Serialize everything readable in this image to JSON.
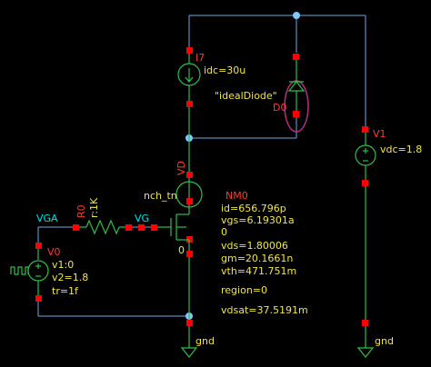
{
  "colors": {
    "background": "#000000",
    "wire": "#6fa8e6",
    "pin": "#ff0000",
    "component": "#2fbf4a",
    "label_red": "#ff3b30",
    "label_yellow": "#f0e642",
    "label_cyan": "#00e0e0",
    "highlight": "#b0327e",
    "junction": "#7ec8ff"
  },
  "components": {
    "i7": {
      "name": "I7",
      "param": "idc=30u"
    },
    "d0": {
      "name": "D0",
      "model": "\"idealDiode\""
    },
    "v1": {
      "name": "V1",
      "param": "vdc=1.8"
    },
    "nm0": {
      "device": "nch_tn",
      "name": "NM0",
      "bulk": "0",
      "op": {
        "id": "id=656.796p",
        "vgs": "vgs=6.19301a",
        "blank": "0",
        "vds": "vds=1.80006",
        "gm": "gm=20.1661n",
        "vth": "vth=471.751m",
        "region": "region=0",
        "vdsat": "vdsat=37.5191m"
      }
    },
    "r0": {
      "name": "R0",
      "param": "r:1K"
    },
    "v0": {
      "name": "V0",
      "v1": "v1:0",
      "v2": "v2=1.8",
      "tr": "tr=1f"
    }
  },
  "nets": {
    "vd": "VD",
    "vg": "VG",
    "vga": "VGA",
    "gnd_left": "gnd",
    "gnd_right": "gnd"
  }
}
